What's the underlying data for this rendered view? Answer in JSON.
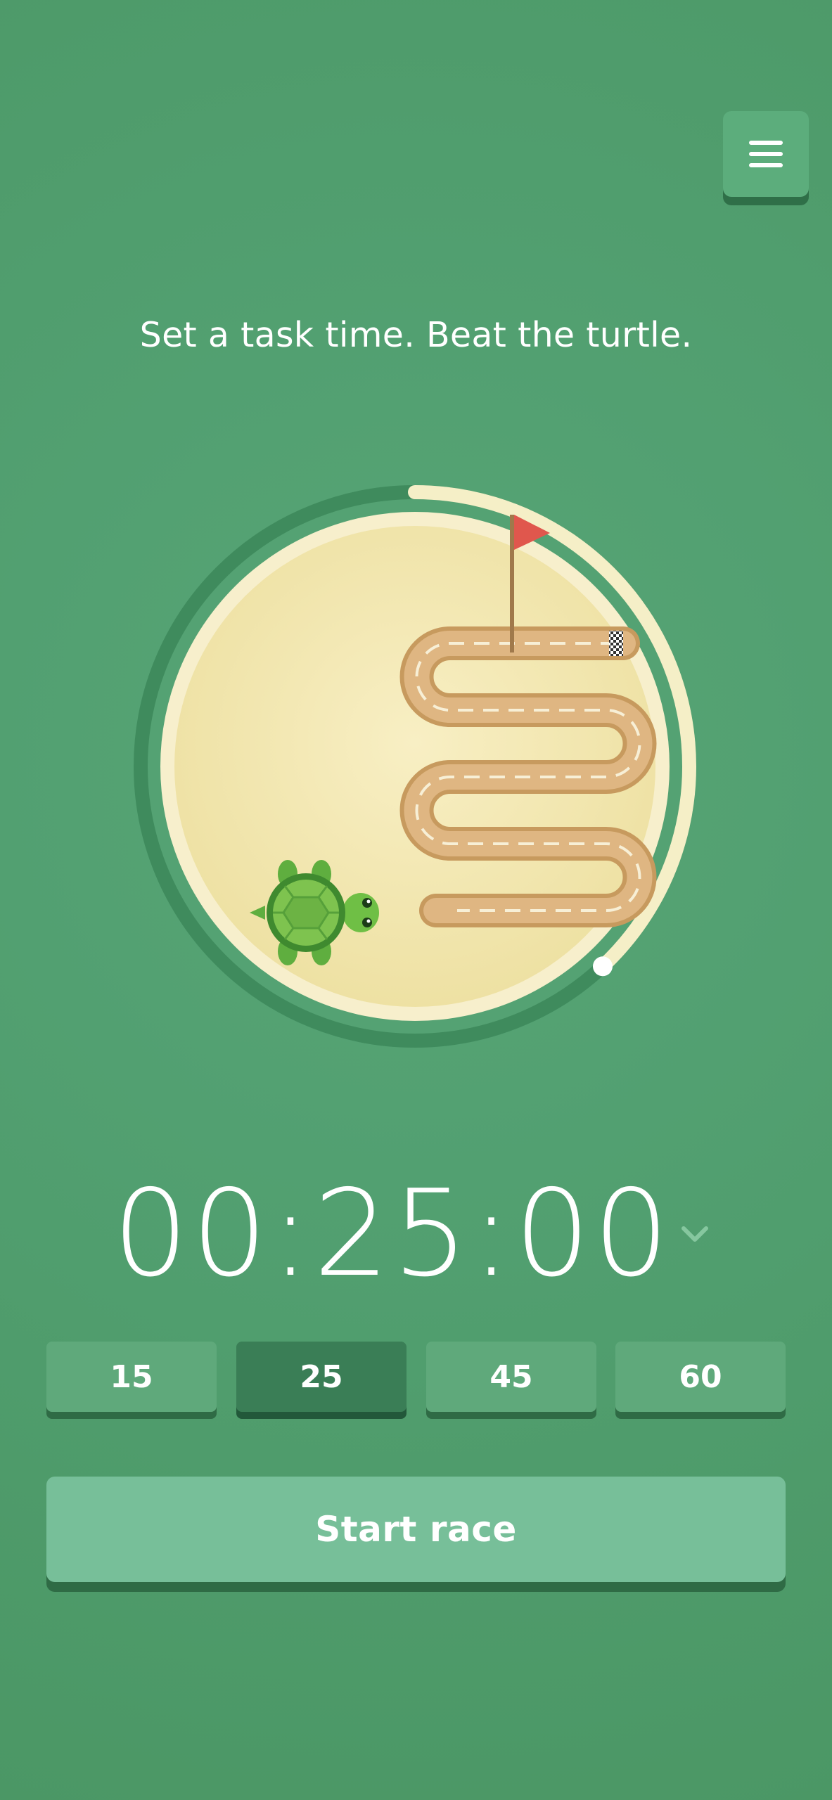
{
  "header": {
    "menu_icon": "hamburger-menu-icon"
  },
  "tagline": "Set a task time. Beat the turtle.",
  "dial": {
    "progress": 0.38,
    "track_color": "#f5efc7",
    "flag_color": "#e0574d",
    "turtle_shell_color": "#7ec34f"
  },
  "timer": {
    "display": "00:25:00",
    "chevron_icon": "chevron-down-icon"
  },
  "presets": [
    {
      "label": "15",
      "active": false
    },
    {
      "label": "25",
      "active": true
    },
    {
      "label": "45",
      "active": false
    },
    {
      "label": "60",
      "active": false
    }
  ],
  "start_label": "Start race",
  "colors": {
    "background": "#52a071",
    "button": "#5fa97b",
    "button_active": "#3a7e56",
    "start_button": "#77bf99"
  }
}
